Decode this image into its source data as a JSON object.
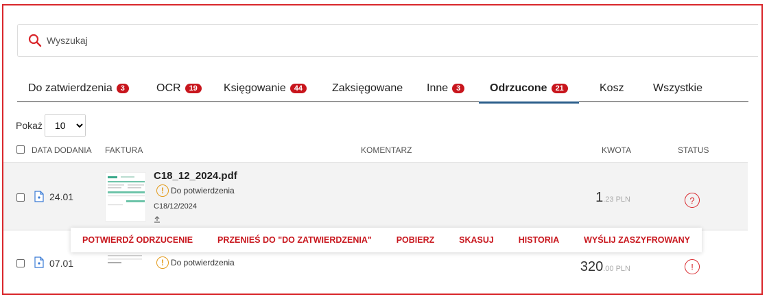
{
  "search": {
    "placeholder": "Wyszukaj"
  },
  "tabs": [
    {
      "label": "Do zatwierdzenia",
      "count": "3"
    },
    {
      "label": "OCR",
      "count": "19"
    },
    {
      "label": "Księgowanie",
      "count": "44"
    },
    {
      "label": "Zaksięgowane",
      "count": ""
    },
    {
      "label": "Inne",
      "count": "3"
    },
    {
      "label": "Odrzucone",
      "count": "21",
      "active": true
    },
    {
      "label": "Kosz",
      "count": ""
    },
    {
      "label": "Wszystkie",
      "count": ""
    }
  ],
  "show": {
    "label": "Pokaż",
    "selected": "10",
    "options": [
      "10"
    ]
  },
  "columns": {
    "date_added": "DATA DODANIA",
    "invoice": "FAKTURA",
    "comment": "KOMENTARZ",
    "amount": "KWOTA",
    "status": "STATUS"
  },
  "rows": [
    {
      "date": "24.01",
      "filename": "C18_12_2024.pdf",
      "status_text": "Do potwierdzenia",
      "invoice_number": "C18/12/2024",
      "amount_int": "1",
      "amount_dec": ".23 PLN",
      "status_icon": "?"
    },
    {
      "date": "07.01",
      "status_text": "Do potwierdzenia",
      "amount_int": "320",
      "amount_dec": ".00 PLN",
      "status_icon": "!"
    }
  ],
  "actions": [
    "POTWIERDŹ ODRZUCENIE",
    "PRZENIEŚ DO \"DO ZATWIERDZENIA\"",
    "POBIERZ",
    "SKASUJ",
    "HISTORIA",
    "WYŚLIJ ZASZYFROWANY"
  ],
  "colors": {
    "accent": "#c8161d",
    "frame": "#d9262b",
    "active_tab_underline": "#2a5d8a",
    "warning": "#e39b1b"
  }
}
